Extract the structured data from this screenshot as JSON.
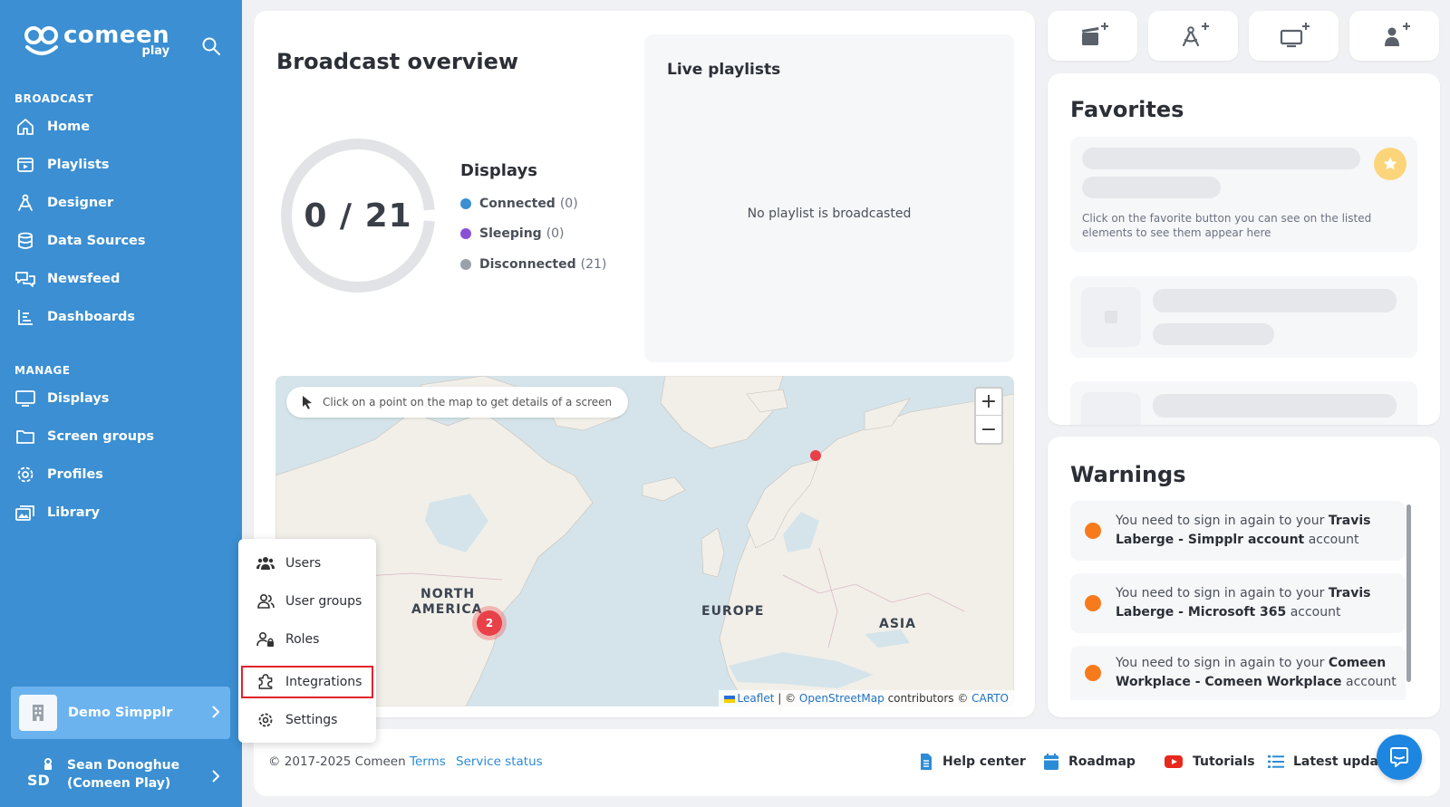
{
  "sidebar": {
    "logo": {
      "main": "comeen",
      "sub": "play"
    },
    "broadcast_label": "BROADCAST",
    "manage_label": "MANAGE",
    "broadcast_items": [
      {
        "label": "Home",
        "icon": "home-icon"
      },
      {
        "label": "Playlists",
        "icon": "playlist-icon"
      },
      {
        "label": "Designer",
        "icon": "designer-icon"
      },
      {
        "label": "Data Sources",
        "icon": "database-icon"
      },
      {
        "label": "Newsfeed",
        "icon": "newsfeed-icon"
      },
      {
        "label": "Dashboards",
        "icon": "dashboard-icon"
      }
    ],
    "manage_items": [
      {
        "label": "Displays",
        "icon": "monitor-icon"
      },
      {
        "label": "Screen groups",
        "icon": "folder-icon"
      },
      {
        "label": "Profiles",
        "icon": "gear-icon"
      },
      {
        "label": "Library",
        "icon": "library-icon"
      }
    ],
    "org": {
      "name": "Demo Simpplr"
    },
    "user": {
      "initials": "SD",
      "name_line1": "Sean Donoghue",
      "name_line2": "(Comeen Play)"
    }
  },
  "popup_menu": {
    "items": [
      {
        "label": "Users"
      },
      {
        "label": "User groups"
      },
      {
        "label": "Roles"
      },
      {
        "label": "Integrations"
      },
      {
        "label": "Settings"
      }
    ],
    "highlighted": "Integrations"
  },
  "overview": {
    "title": "Broadcast overview",
    "counter": "0 / 21",
    "connected_fraction": 0.0,
    "displays_title": "Displays",
    "legend": [
      {
        "label": "Connected",
        "count": "(0)",
        "color": "#3b8fd2"
      },
      {
        "label": "Sleeping",
        "count": "(0)",
        "color": "#8b4fd6"
      },
      {
        "label": "Disconnected",
        "count": "(21)",
        "color": "#9aa1aa"
      }
    ],
    "live_title": "Live playlists",
    "live_empty": "No playlist is broadcasted"
  },
  "map": {
    "hint": "Click on a point on the map to get details of a screen",
    "zoom_in": "+",
    "zoom_out": "−",
    "labels": {
      "north_america_1": "NORTH",
      "north_america_2": "AMERICA",
      "europe": "EUROPE",
      "asia": "ASIA"
    },
    "cluster_count": "2",
    "attribution": {
      "leaflet": "Leaflet",
      "sep1": " | © ",
      "osm": "OpenStreetMap",
      "contrib": " contributors © ",
      "carto": "CARTO"
    }
  },
  "favorites": {
    "title": "Favorites",
    "hint": "Click on the favorite button you can see on the listed elements to see them appear here"
  },
  "warnings": {
    "title": "Warnings",
    "items": [
      {
        "prefix": "You need to sign in again to your ",
        "bold": "Travis Laberge - Simpplr account",
        "suffix": " account"
      },
      {
        "prefix": "You need to sign in again to your ",
        "bold": "Travis Laberge - Microsoft 365",
        "suffix": " account"
      },
      {
        "prefix": "You need to sign in again to your ",
        "bold": "Comeen Workplace - Comeen Workplace",
        "suffix": " account"
      }
    ]
  },
  "footer": {
    "copyright": "© 2017-2025 Comeen",
    "terms": "Terms",
    "status": "Service status",
    "help": "Help center",
    "roadmap": "Roadmap",
    "tutorials": "Tutorials",
    "updates": "Latest update"
  },
  "colors": {
    "sidebar": "#3b8fd2",
    "accent": "#2b8cd6",
    "warning": "#f77b1c",
    "map_marker": "#e8414a"
  }
}
